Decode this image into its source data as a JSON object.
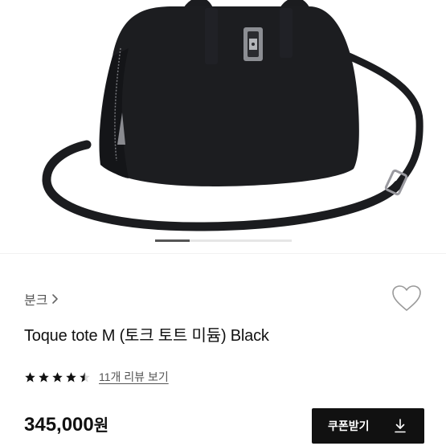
{
  "product": {
    "brand": "분크",
    "title": "Toque tote M (토크 토트 미듐) Black",
    "price": "345,000",
    "currency": "원"
  },
  "rating": {
    "value": 4.5,
    "max": 5,
    "review_link": "11개 리뷰 보기"
  },
  "gallery": {
    "current_index": 1,
    "progress_fraction": 0.25
  },
  "actions": {
    "coupon_label": "쿠폰받기"
  },
  "icons": {
    "brand_chevron": "chevron-right-icon",
    "wishlist": "heart-outline-icon",
    "coupon": "download-icon",
    "stars": "star-icon"
  },
  "colors": {
    "bag": "#1b1c1f",
    "button_bg": "#111111",
    "text_primary": "#111111",
    "text_secondary": "#555555"
  }
}
